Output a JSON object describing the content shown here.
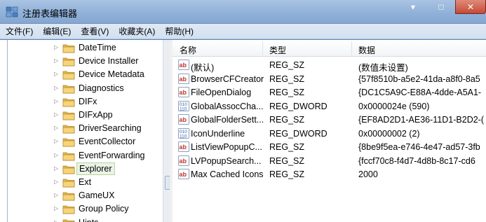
{
  "window": {
    "title": "注册表编辑器",
    "controls": {
      "minimize": "▾",
      "maximize": "□",
      "close": "✕"
    }
  },
  "menu": [
    "文件(F)",
    "编辑(E)",
    "查看(V)",
    "收藏夹(A)",
    "帮助(H)"
  ],
  "tree": {
    "items": [
      {
        "label": "DateTime",
        "selected": false
      },
      {
        "label": "Device Installer",
        "selected": false
      },
      {
        "label": "Device Metadata",
        "selected": false
      },
      {
        "label": "Diagnostics",
        "selected": false
      },
      {
        "label": "DIFx",
        "selected": false
      },
      {
        "label": "DIFxApp",
        "selected": false
      },
      {
        "label": "DriverSearching",
        "selected": false
      },
      {
        "label": "EventCollector",
        "selected": false
      },
      {
        "label": "EventForwarding",
        "selected": false
      },
      {
        "label": "Explorer",
        "selected": true
      },
      {
        "label": "Ext",
        "selected": false
      },
      {
        "label": "GameUX",
        "selected": false
      },
      {
        "label": "Group Policy",
        "selected": false
      },
      {
        "label": "Hints",
        "selected": false
      }
    ]
  },
  "list": {
    "headers": {
      "name": "名称",
      "type": "类型",
      "data": "数据"
    },
    "rows": [
      {
        "icon": "string-value-icon",
        "name": "(默认)",
        "type": "REG_SZ",
        "data": "(数值未设置)"
      },
      {
        "icon": "string-value-icon",
        "name": "BrowserCFCreator",
        "type": "REG_SZ",
        "data": "{57f8510b-a5e2-41da-a8f0-8a5"
      },
      {
        "icon": "string-value-icon",
        "name": "FileOpenDialog",
        "type": "REG_SZ",
        "data": "{DC1C5A9C-E88A-4dde-A5A1-"
      },
      {
        "icon": "dword-value-icon",
        "name": "GlobalAssocCha...",
        "type": "REG_DWORD",
        "data": "0x0000024e (590)"
      },
      {
        "icon": "string-value-icon",
        "name": "GlobalFolderSett...",
        "type": "REG_SZ",
        "data": "{EF8AD2D1-AE36-11D1-B2D2-("
      },
      {
        "icon": "dword-value-icon",
        "name": "IconUnderline",
        "type": "REG_DWORD",
        "data": "0x00000002 (2)"
      },
      {
        "icon": "string-value-icon",
        "name": "ListViewPopupC...",
        "type": "REG_SZ",
        "data": "{8be9f5ea-e746-4e47-ad57-3fb"
      },
      {
        "icon": "string-value-icon",
        "name": "LVPopupSearch...",
        "type": "REG_SZ",
        "data": "{fccf70c8-f4d7-4d8b-8c17-cd6"
      },
      {
        "icon": "string-value-icon",
        "name": "Max Cached Icons",
        "type": "REG_SZ",
        "data": "2000"
      }
    ]
  },
  "colors": {
    "title_bar": "#8fb0d8",
    "selection_fill": "#eaf4e6",
    "string_icon": "#c0392b",
    "dword_icon": "#2d5fa8"
  }
}
